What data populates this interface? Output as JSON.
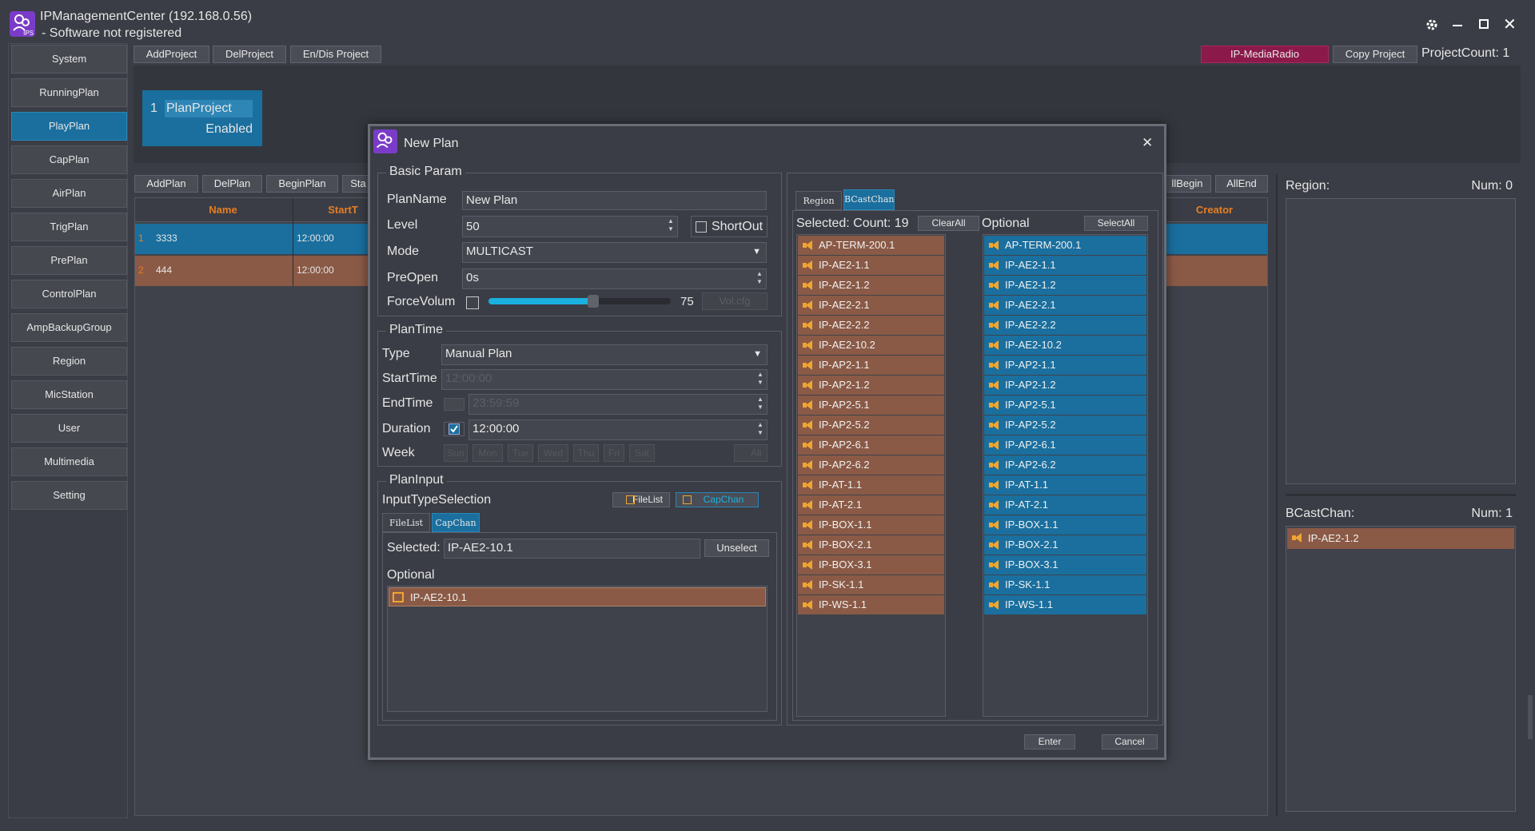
{
  "window": {
    "title_line1": "IPManagementCenter (192.168.0.56)",
    "title_line2": "- Software not registered",
    "logo_text": "IPS"
  },
  "toolbar": {
    "add_project": "AddProject",
    "del_project": "DelProject",
    "endis_project": "En/Dis Project",
    "media_radio": "IP-MediaRadio",
    "copy_project": "Copy Project",
    "project_count": "ProjectCount: 1"
  },
  "sidebar": {
    "items": [
      {
        "label": "System"
      },
      {
        "label": "RunningPlan"
      },
      {
        "label": "PlayPlan"
      },
      {
        "label": "CapPlan"
      },
      {
        "label": "AirPlan"
      },
      {
        "label": "TrigPlan"
      },
      {
        "label": "PrePlan"
      },
      {
        "label": "ControlPlan"
      },
      {
        "label": "AmpBackupGroup"
      },
      {
        "label": "Region"
      },
      {
        "label": "MicStation"
      },
      {
        "label": "User"
      },
      {
        "label": "Multimedia"
      },
      {
        "label": "Setting"
      }
    ]
  },
  "project_card": {
    "index": "1",
    "name": "PlanProject",
    "status": "Enabled"
  },
  "plan_toolbar": {
    "add_plan": "AddPlan",
    "del_plan": "DelPlan",
    "begin_plan": "BeginPlan",
    "stop_plan": "Sta",
    "all_begin": "llBegin",
    "all_end": "AllEnd"
  },
  "plan_table": {
    "headers": {
      "name": "Name",
      "start": "StartT",
      "creator": "Creator"
    },
    "rows": [
      {
        "no": "1",
        "name": "3333",
        "start": "12:00:00"
      },
      {
        "no": "2",
        "name": "444",
        "start": "12:00:00"
      }
    ]
  },
  "right_panel": {
    "region_label": "Region:",
    "region_num": "Num: 0",
    "bcast_label": "BCastChan:",
    "bcast_num": "Num: 1",
    "bcast_items": [
      "IP-AE2-1.2"
    ]
  },
  "dialog": {
    "title": "New Plan",
    "close": "✕",
    "basic": {
      "title": "Basic Param",
      "plan_name_label": "PlanName",
      "plan_name_value": "New Plan",
      "level_label": "Level",
      "level_value": "50",
      "shortout_label": "ShortOut",
      "mode_label": "Mode",
      "mode_value": "MULTICAST",
      "preopen_label": "PreOpen",
      "preopen_value": "0s",
      "forcevol_label": "ForceVolum",
      "volume_value": "75",
      "volume_fraction": 0.75,
      "vol_button": "Vol.cfg"
    },
    "plantime": {
      "title": "PlanTime",
      "type_label": "Type",
      "type_value": "Manual Plan",
      "start_label": "StartTime",
      "start_value": "12:00:00",
      "end_label": "EndTime",
      "end_value": "23:59:59",
      "duration_label": "Duration",
      "duration_value": "12:00:00",
      "week_label": "Week",
      "week_days": [
        "Sun",
        "Mon",
        "Tue",
        "Wed",
        "Thu",
        "Fri",
        "Sat"
      ],
      "all_label": "All"
    },
    "planinput": {
      "title": "PlanInput",
      "selection_label": "InputTypeSelection",
      "filelist_btn": "FileList",
      "capchan_btn": "CapChan",
      "tab_filelist": "FileList",
      "tab_capchan": "CapChan",
      "selected_label": "Selected:",
      "selected_value": "IP-AE2-10.1",
      "unselect": "Unselect",
      "optional_label": "Optional",
      "optional_items": [
        "IP-AE2-10.1"
      ]
    },
    "channels": {
      "tab_region": "Region",
      "tab_bcast": "BCastChan",
      "selected_label": "Selected: Count: 19",
      "clear_all": "ClearAll",
      "optional_label": "Optional",
      "select_all": "SelectAll",
      "selected_items": [
        "AP-TERM-200.1",
        "IP-AE2-1.1",
        "IP-AE2-1.2",
        "IP-AE2-2.1",
        "IP-AE2-2.2",
        "IP-AE2-10.2",
        "IP-AP2-1.1",
        "IP-AP2-1.2",
        "IP-AP2-5.1",
        "IP-AP2-5.2",
        "IP-AP2-6.1",
        "IP-AP2-6.2",
        "IP-AT-1.1",
        "IP-AT-2.1",
        "IP-BOX-1.1",
        "IP-BOX-2.1",
        "IP-BOX-3.1",
        "IP-SK-1.1",
        "IP-WS-1.1"
      ],
      "optional_items": [
        "AP-TERM-200.1",
        "IP-AE2-1.1",
        "IP-AE2-1.2",
        "IP-AE2-2.1",
        "IP-AE2-2.2",
        "IP-AE2-10.2",
        "IP-AP2-1.1",
        "IP-AP2-1.2",
        "IP-AP2-5.1",
        "IP-AP2-5.2",
        "IP-AP2-6.1",
        "IP-AP2-6.2",
        "IP-AT-1.1",
        "IP-AT-2.1",
        "IP-BOX-1.1",
        "IP-BOX-2.1",
        "IP-BOX-3.1",
        "IP-SK-1.1",
        "IP-WS-1.1"
      ]
    },
    "enter": "Enter",
    "cancel": "Cancel"
  },
  "colors": {
    "accent": "#1a6f9e",
    "selected_row": "#8a5a46",
    "header_text": "#e87e22",
    "media_radio": "#8b1a4a"
  }
}
